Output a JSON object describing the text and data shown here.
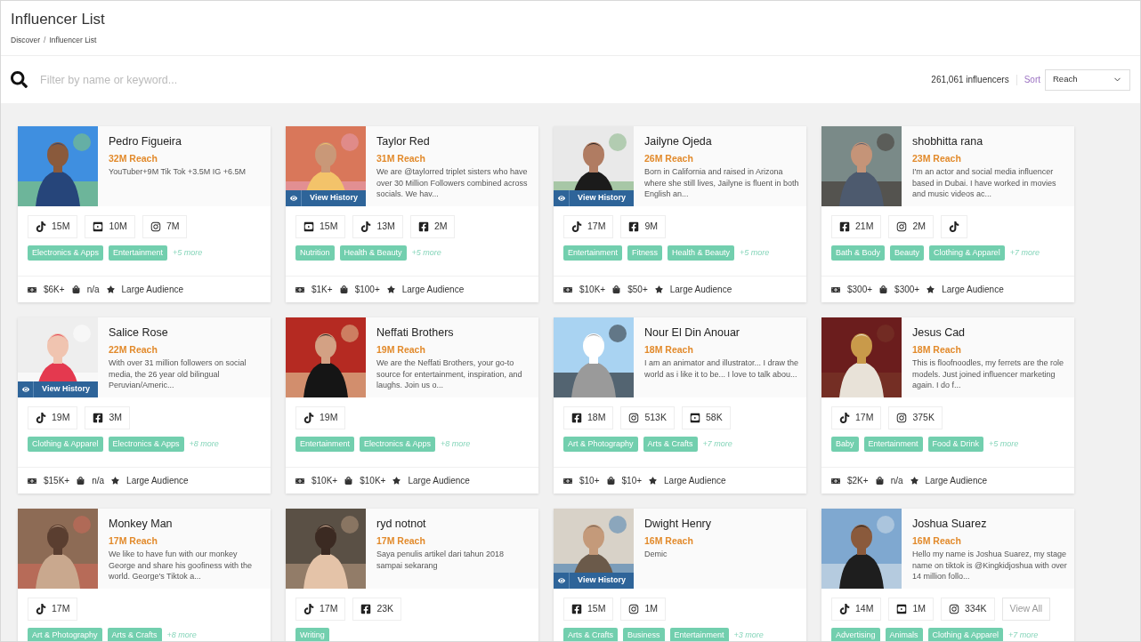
{
  "page": {
    "title": "Influencer List",
    "breadcrumb": [
      "Discover",
      "Influencer List"
    ],
    "breadcrumb_separator": "/"
  },
  "toolbar": {
    "search_placeholder": "Filter by name or keyword...",
    "count": "261,061 influencers",
    "sort_label": "Sort",
    "sort_value": "Reach"
  },
  "cards": [
    {
      "name": "Pedro Figueira",
      "reach": "32M Reach",
      "bio": "YouTuber+9M Tik Tok +3.5M IG +6.5M",
      "platforms": [
        {
          "kind": "tiktok",
          "count": "15M"
        },
        {
          "kind": "youtube",
          "count": "10M"
        },
        {
          "kind": "instagram",
          "count": "7M"
        }
      ],
      "tags": [
        "Electronics & Apps",
        "Entertainment"
      ],
      "more": "+5 more",
      "footer": {
        "price": "$6K+",
        "product": "n/a",
        "audience": "Large Audience"
      }
    },
    {
      "name": "Taylor Red",
      "reach": "31M Reach",
      "bio": "We are @taylorred triplet sisters who have over 30 Million Followers combined across socials. We hav...",
      "history": "View History",
      "platforms": [
        {
          "kind": "youtube",
          "count": "15M"
        },
        {
          "kind": "tiktok",
          "count": "13M"
        },
        {
          "kind": "facebook",
          "count": "2M"
        }
      ],
      "tags": [
        "Nutrition",
        "Health & Beauty"
      ],
      "more": "+5 more",
      "footer": {
        "price": "$1K+",
        "product": "$100+",
        "audience": "Large Audience"
      }
    },
    {
      "name": "Jailyne Ojeda",
      "reach": "26M Reach",
      "bio": "Born in California and raised in Arizona where she still lives, Jailyne is fluent in both English an...",
      "history": "View History",
      "platforms": [
        {
          "kind": "tiktok",
          "count": "17M"
        },
        {
          "kind": "facebook",
          "count": "9M"
        }
      ],
      "tags": [
        "Entertainment",
        "Fitness",
        "Health & Beauty"
      ],
      "more": "+5 more",
      "footer": {
        "price": "$10K+",
        "product": "$50+",
        "audience": "Large Audience"
      }
    },
    {
      "name": "shobhitta rana",
      "reach": "23M Reach",
      "bio": "I'm an actor and social media influencer based in Dubai. I have worked in movies and music videos ac...",
      "platforms": [
        {
          "kind": "facebook",
          "count": "21M"
        },
        {
          "kind": "instagram",
          "count": "2M"
        },
        {
          "kind": "tiktok"
        }
      ],
      "tags": [
        "Bath & Body",
        "Beauty",
        "Clothing & Apparel"
      ],
      "more": "+7 more",
      "footer": {
        "price": "$300+",
        "product": "$300+",
        "audience": "Large Audience"
      }
    },
    {
      "name": "Salice Rose",
      "reach": "22M Reach",
      "bio": "With over 31 million followers on social media, the 26 year old bilingual Peruvian/Americ...",
      "history": "View History",
      "platforms": [
        {
          "kind": "tiktok",
          "count": "19M"
        },
        {
          "kind": "facebook",
          "count": "3M"
        }
      ],
      "tags": [
        "Clothing & Apparel",
        "Electronics & Apps"
      ],
      "more": "+8 more",
      "footer": {
        "price": "$15K+",
        "product": "n/a",
        "audience": "Large Audience"
      }
    },
    {
      "name": "Neffati Brothers",
      "reach": "19M Reach",
      "bio": "We are the Neffati Brothers, your go-to source for entertainment, inspiration, and laughs. Join us o...",
      "platforms": [
        {
          "kind": "tiktok",
          "count": "19M"
        }
      ],
      "tags": [
        "Entertainment",
        "Electronics & Apps"
      ],
      "more": "+8 more",
      "footer": {
        "price": "$10K+",
        "product": "$10K+",
        "audience": "Large Audience"
      }
    },
    {
      "name": "Nour El Din Anouar",
      "reach": "18M Reach",
      "bio": "I am an animator and illustrator... I draw the world as i like it to be...  I love to talk abou...",
      "platforms": [
        {
          "kind": "facebook",
          "count": "18M"
        },
        {
          "kind": "instagram",
          "count": "513K"
        },
        {
          "kind": "youtube",
          "count": "58K"
        }
      ],
      "tags": [
        "Art & Photography",
        "Arts & Crafts"
      ],
      "more": "+7 more",
      "footer": {
        "price": "$10+",
        "product": "$10+",
        "audience": "Large Audience"
      }
    },
    {
      "name": "Jesus Cad",
      "reach": "18M Reach",
      "bio": "This is floofnoodles, my ferrets are the role models. Just joined influencer marketing again. I do f...",
      "platforms": [
        {
          "kind": "tiktok",
          "count": "17M"
        },
        {
          "kind": "instagram",
          "count": "375K"
        }
      ],
      "tags": [
        "Baby",
        "Entertainment",
        "Food & Drink"
      ],
      "more": "+5 more",
      "footer": {
        "price": "$2K+",
        "product": "n/a",
        "audience": "Large Audience"
      }
    },
    {
      "name": "Monkey Man",
      "reach": "17M Reach",
      "bio": "We like to have fun with our monkey George and share his goofiness with the world. George's Tiktok a...",
      "platforms": [
        {
          "kind": "tiktok",
          "count": "17M"
        }
      ],
      "tags": [
        "Art & Photography",
        "Arts & Crafts"
      ],
      "more": "+8 more"
    },
    {
      "name": "ryd notnot",
      "reach": "17M Reach",
      "bio": "Saya penulis artikel dari tahun 2018 sampai sekarang",
      "platforms": [
        {
          "kind": "tiktok",
          "count": "17M"
        },
        {
          "kind": "facebook",
          "count": "23K"
        }
      ],
      "tags": [
        "Writing"
      ]
    },
    {
      "name": "Dwight Henry",
      "reach": "16M Reach",
      "bio": "Demic",
      "history": "View History",
      "platforms": [
        {
          "kind": "facebook",
          "count": "15M"
        },
        {
          "kind": "instagram",
          "count": "1M"
        }
      ],
      "tags": [
        "Arts & Crafts",
        "Business",
        "Entertainment"
      ],
      "more": "+3 more"
    },
    {
      "name": "Joshua Suarez",
      "reach": "16M Reach",
      "bio": "Hello my name is Joshua Suarez, my stage name on tiktok is @Kingkidjoshua with over 14 million follo...",
      "platforms": [
        {
          "kind": "tiktok",
          "count": "14M"
        },
        {
          "kind": "youtube",
          "count": "1M"
        },
        {
          "kind": "instagram",
          "count": "334K"
        },
        {
          "kind": "view_all",
          "label": "View All"
        }
      ],
      "tags": [
        "Advertising",
        "Animals",
        "Clothing & Apparel"
      ],
      "more": "+7 more"
    }
  ]
}
